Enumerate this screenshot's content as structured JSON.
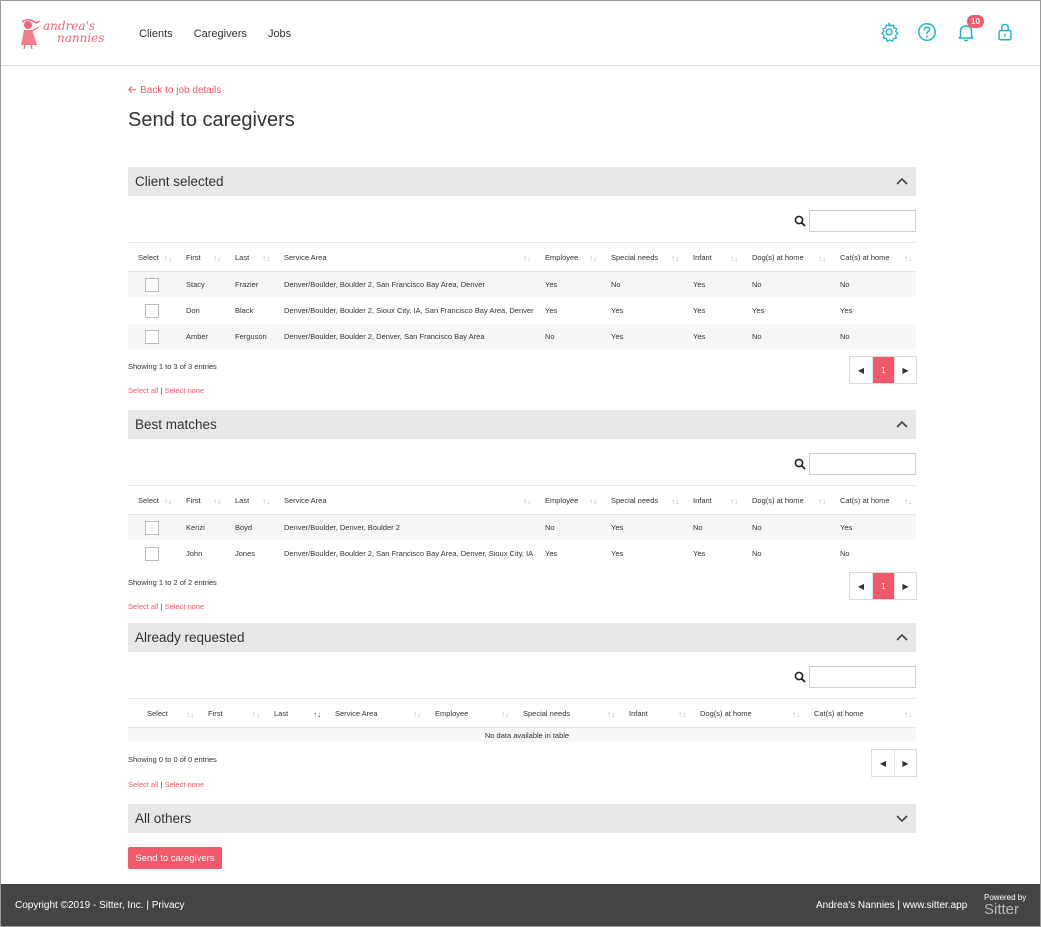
{
  "brand": {
    "line1": "andrea's",
    "line2": "nannies",
    "color": "#f0657a"
  },
  "nav": {
    "clients": "Clients",
    "caregivers": "Caregivers",
    "jobs": "Jobs"
  },
  "top_icons": {
    "settings": "gear-icon",
    "help": "question-circle-icon",
    "notifications": "bell-icon",
    "notification_count": "10",
    "lock": "lock-icon",
    "color": "#1fb5c6"
  },
  "back_link": "Back to job details",
  "page_title": "Send to caregivers",
  "accent": "#f25a6a",
  "sections": {
    "client_selected": {
      "title": "Client selected",
      "columns": [
        "Select",
        "First",
        "Last",
        "Service Area",
        "Employee",
        "Special needs",
        "Infant",
        "Dog(s) at home",
        "Cat(s) at home"
      ],
      "rows": [
        {
          "first": "Stacy",
          "last": "Frazier",
          "area": "Denver/Boulder, Boulder 2, San Francisco Bay Area, Denver",
          "employee": "Yes",
          "special": "No",
          "infant": "Yes",
          "dogs": "No",
          "cats": "No"
        },
        {
          "first": "Don",
          "last": "Black",
          "area": "Denver/Boulder, Boulder 2, Sioux City, IA, San Francisco Bay Area, Denver",
          "employee": "Yes",
          "special": "Yes",
          "infant": "Yes",
          "dogs": "Yes",
          "cats": "Yes"
        },
        {
          "first": "Amber",
          "last": "Ferguson",
          "area": "Denver/Boulder, Boulder 2, Denver, San Francisco Bay Area",
          "employee": "No",
          "special": "Yes",
          "infant": "Yes",
          "dogs": "No",
          "cats": "No"
        }
      ],
      "info": "Showing 1 to 3 of 3 entries",
      "page": "1"
    },
    "best_matches": {
      "title": "Best matches",
      "columns": [
        "Select",
        "First",
        "Last",
        "Service Area",
        "Employee",
        "Special needs",
        "Infant",
        "Dog(s) at home",
        "Cat(s) at home"
      ],
      "rows": [
        {
          "first": "Kenzi",
          "last": "Boyd",
          "area": "Denver/Boulder, Denver, Boulder 2",
          "employee": "No",
          "special": "Yes",
          "infant": "No",
          "dogs": "No",
          "cats": "Yes"
        },
        {
          "first": "John",
          "last": "Jones",
          "area": "Denver/Boulder, Boulder 2, San Francisco Bay Area, Denver, Sioux City, IA",
          "employee": "Yes",
          "special": "Yes",
          "infant": "Yes",
          "dogs": "No",
          "cats": "No"
        }
      ],
      "info": "Showing 1 to 2 of 2 entries",
      "page": "1"
    },
    "already_requested": {
      "title": "Already requested",
      "columns": [
        "Select",
        "First",
        "Last",
        "Service Area",
        "Employee",
        "Special needs",
        "Infant",
        "Dog(s) at home",
        "Cat(s) at home"
      ],
      "empty": "No data available in table",
      "info": "Showing 0 to 0 of 0 entries"
    },
    "all_others": {
      "title": "All others"
    }
  },
  "select_all": "Select all",
  "select_none": "Select none",
  "separator": "|",
  "send_button": "Send to caregivers",
  "footer": {
    "copyright": "Copyright ©2019 - Sitter, Inc.",
    "privacy": "Privacy",
    "sep": "|",
    "right": "Andrea's Nannies | www.sitter.app",
    "powered_by": "Powered by",
    "sitter": "Sitter"
  }
}
